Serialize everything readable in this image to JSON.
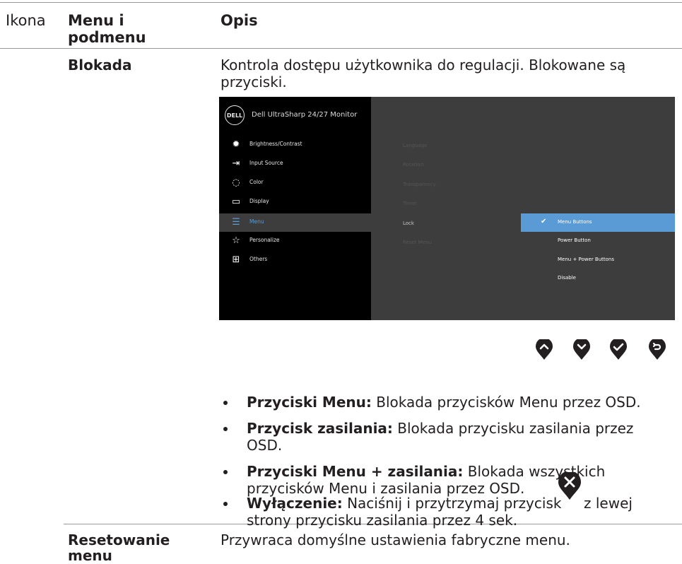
{
  "header": {
    "col1": "Ikona",
    "col2": "Menu i podmenu",
    "col2_line1": "Menu i",
    "col2_line2": "podmenu",
    "col3": "Opis"
  },
  "row_lock": {
    "name": "Blokada",
    "desc_line1": "Kontrola dostępu użytkownika do regulacji. Blokowane są",
    "desc_line2": "przyciski."
  },
  "osd": {
    "logo": "DELL",
    "title": "Dell UltraSharp 24/27 Monitor",
    "menu": [
      {
        "label": "Brightness/Contrast",
        "icon": "brightness-icon"
      },
      {
        "label": "Input Source",
        "icon": "input-source-icon"
      },
      {
        "label": "Color",
        "icon": "color-icon"
      },
      {
        "label": "Display",
        "icon": "display-icon"
      },
      {
        "label": "Menu",
        "icon": "menu-icon"
      },
      {
        "label": "Personalize",
        "icon": "star-icon"
      },
      {
        "label": "Others",
        "icon": "others-icon"
      }
    ],
    "submenu": [
      "Language",
      "Rotation",
      "Transparency",
      "Timer",
      "Lock",
      "Reset Menu"
    ],
    "options": [
      "Menu Buttons",
      "Power Button",
      "Menu + Power Buttons",
      "Disable"
    ],
    "selected_menu": "Menu",
    "selected_submenu": "Lock",
    "selected_option": "Menu Buttons",
    "accent": "#5b9bd5"
  },
  "nav_buttons": [
    "up-arrow-icon",
    "down-arrow-icon",
    "check-icon",
    "back-icon"
  ],
  "bullets": [
    {
      "bold": "Przyciski Menu:",
      "text": " Blokada przycisków Menu przez OSD."
    },
    {
      "bold": "Przycisk zasilania:",
      "text": " Blokada przycisku zasilania przez",
      "line2": "OSD."
    },
    {
      "bold": "Przyciski Menu + zasilania:",
      "text": " Blokada wszystkich",
      "line2": "przycisków Menu i zasilania przez OSD."
    },
    {
      "bold": "Wyłączenie:",
      "text": " Naciśnij i przytrzymaj przycisk",
      "after_icon": "z lewej",
      "line2": "strony przycisku zasilania przez 4 sek."
    }
  ],
  "row_reset": {
    "name_line1": "Resetowanie",
    "name_line2": "menu",
    "desc": "Przywraca domyślne ustawienia fabryczne menu."
  }
}
